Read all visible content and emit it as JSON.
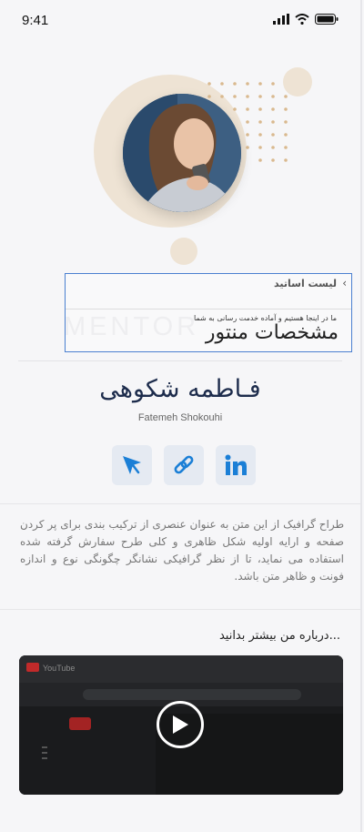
{
  "status": {
    "time": "9:41"
  },
  "overlay": {
    "title": "لیست اساتید",
    "subtitle": "ما در اینجا هستیم و آماده خدمت رسانی به شما",
    "heading": "مشخصات منتور"
  },
  "watermark": "MENTOR",
  "profile": {
    "name_fa": "فـاطمه شکوهی",
    "name_en": "Fatemeh Shokouhi"
  },
  "socials": [
    {
      "icon": "send-icon"
    },
    {
      "icon": "link-icon"
    },
    {
      "icon": "linkedin-icon"
    }
  ],
  "bio": "طراح گرافیک از این متن به عنوان عنصری از ترکیب بندی برای پر کردن صفحه و ارایه اولیه شکل ظاهری و کلی طرح سفارش گرفته شده استفاده می نماید، تا از نظر گرافیکی نشانگر چگونگی نوع و اندازه فونت و ظاهر متن باشد.",
  "more_title": "...درباره من بیشتر بدانید",
  "video": {
    "label": "YouTube"
  },
  "colors": {
    "accent": "#1b7fd6",
    "beige": "#eee3d4",
    "dots": "#d9b98f",
    "name": "#1d2c4c"
  }
}
